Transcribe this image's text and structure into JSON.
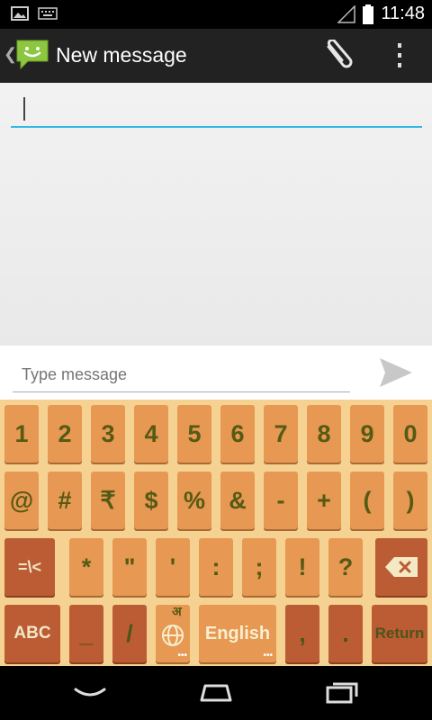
{
  "status": {
    "time": "11:48"
  },
  "header": {
    "title": "New message"
  },
  "recipients": {
    "value": ""
  },
  "compose": {
    "placeholder": "Type message"
  },
  "keyboard": {
    "row1": [
      "1",
      "2",
      "3",
      "4",
      "5",
      "6",
      "7",
      "8",
      "9",
      "0"
    ],
    "row2": [
      "@",
      "#",
      "₹",
      "$",
      "%",
      "&",
      "-",
      "+",
      "(",
      ")"
    ],
    "row3": [
      "=\\<",
      "*",
      "\"",
      "'",
      ":",
      ";",
      "!",
      "?"
    ],
    "row4": {
      "abc": "ABC",
      "underscore": "_",
      "slash": "/",
      "lang_glyph": "अ",
      "english": "English",
      "comma": ",",
      "period": ".",
      "return": "Return"
    }
  },
  "colors": {
    "key_light": "#e79852",
    "key_dark": "#bb5c34",
    "keyboard_bg": "#f5d291",
    "accent": "#33b5e5"
  },
  "icons": [
    "gallery-icon",
    "keyboard-icon",
    "signal-icon",
    "battery-icon",
    "back-icon",
    "messaging-app-icon",
    "attach-icon",
    "overflow-menu-icon",
    "send-icon",
    "backspace-icon",
    "globe-icon",
    "nav-back-icon",
    "nav-home-icon",
    "nav-recents-icon"
  ]
}
